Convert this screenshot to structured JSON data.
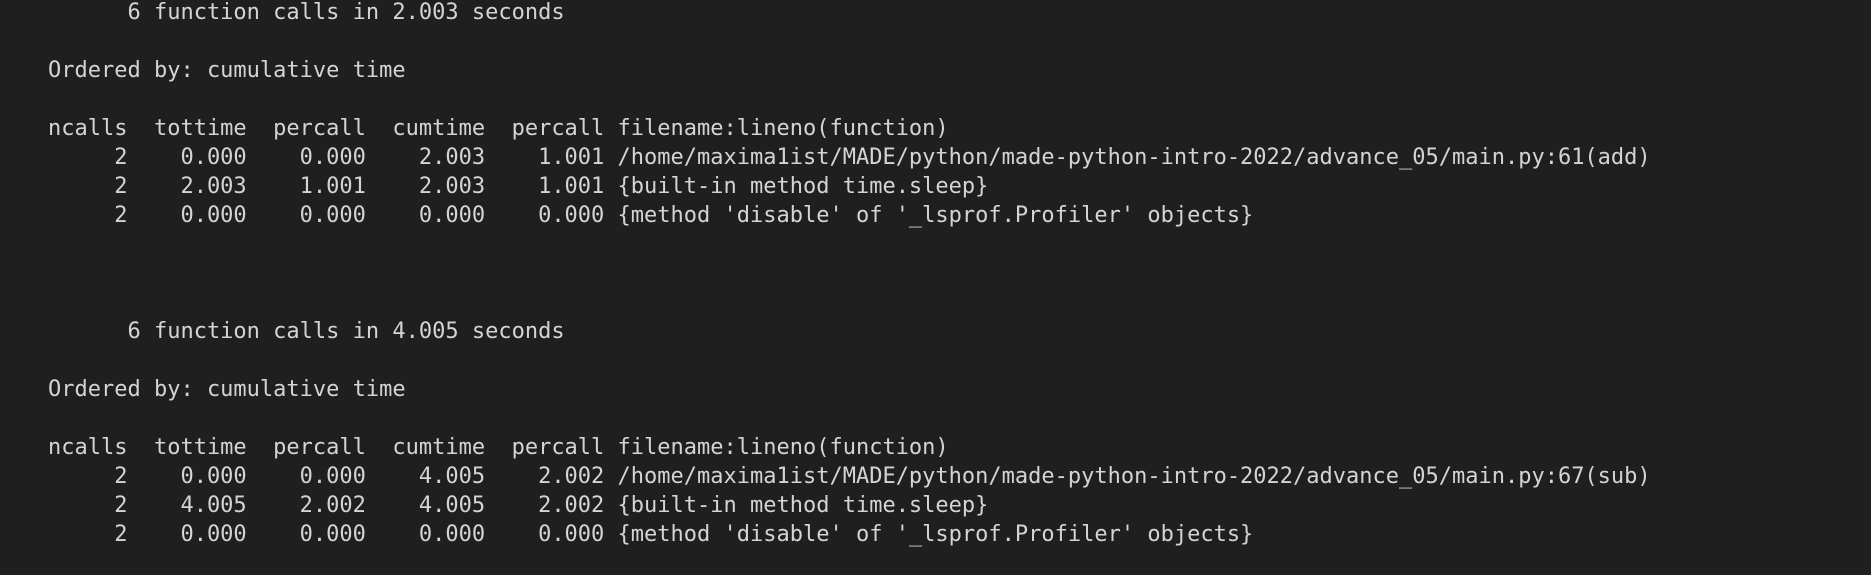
{
  "terminal": {
    "lines": [
      "      6 function calls in 2.003 seconds",
      "",
      "Ordered by: cumulative time",
      "",
      "ncalls  tottime  percall  cumtime  percall filename:lineno(function)",
      "     2    0.000    0.000    2.003    1.001 /home/maxima1ist/MADE/python/made-python-intro-2022/advance_05/main.py:61(add)",
      "     2    2.003    1.001    2.003    1.001 {built-in method time.sleep}",
      "     2    0.000    0.000    0.000    0.000 {method 'disable' of '_lsprof.Profiler' objects}",
      "",
      "",
      "",
      "      6 function calls in 4.005 seconds",
      "",
      "Ordered by: cumulative time",
      "",
      "ncalls  tottime  percall  cumtime  percall filename:lineno(function)",
      "     2    0.000    0.000    4.005    2.002 /home/maxima1ist/MADE/python/made-python-intro-2022/advance_05/main.py:67(sub)",
      "     2    4.005    2.002    4.005    2.002 {built-in method time.sleep}",
      "     2    0.000    0.000    0.000    0.000 {method 'disable' of '_lsprof.Profiler' objects}"
    ]
  }
}
